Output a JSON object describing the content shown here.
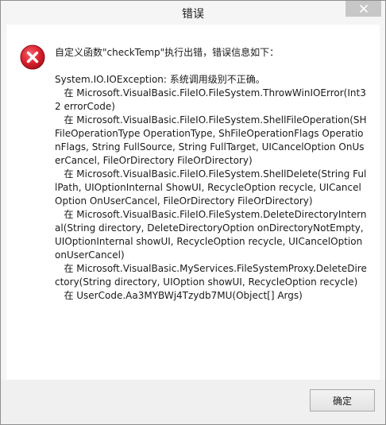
{
  "window": {
    "title": "错误"
  },
  "message": {
    "header": "自定义函数\"checkTemp\"执行出错，错误信息如下：",
    "body": "System.IO.IOException: 系统调用级别不正确。\n   在 Microsoft.VisualBasic.FileIO.FileSystem.ThrowWinIOError(Int32 errorCode)\n   在 Microsoft.VisualBasic.FileIO.FileSystem.ShellFileOperation(SHFileOperationType OperationType, ShFileOperationFlags OperationFlags, String FullSource, String FullTarget, UICancelOption OnUserCancel, FileOrDirectory FileOrDirectory)\n   在 Microsoft.VisualBasic.FileIO.FileSystem.ShellDelete(String FullPath, UIOptionInternal ShowUI, RecycleOption recycle, UICancelOption OnUserCancel, FileOrDirectory FileOrDirectory)\n   在 Microsoft.VisualBasic.FileIO.FileSystem.DeleteDirectoryInternal(String directory, DeleteDirectoryOption onDirectoryNotEmpty, UIOptionInternal showUI, RecycleOption recycle, UICancelOption onUserCancel)\n   在 Microsoft.VisualBasic.MyServices.FileSystemProxy.DeleteDirectory(String directory, UIOption showUI, RecycleOption recycle)\n   在 UserCode.Aa3MYBWj4Tzydb7MU(Object[] Args)"
  },
  "buttons": {
    "ok_label": "确定"
  },
  "icons": {
    "error": "error-icon",
    "close": "close-icon"
  },
  "colors": {
    "error_red": "#d9202e",
    "close_button": "#c7c7c7"
  }
}
